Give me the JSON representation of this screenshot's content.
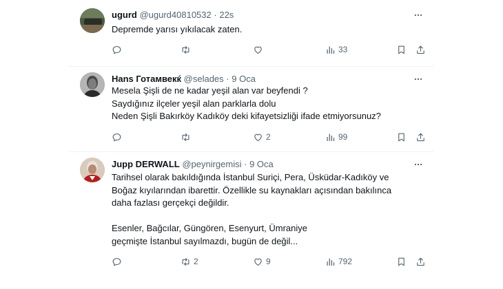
{
  "tweets": [
    {
      "name": "ugurd",
      "handle": "@ugurd40810532",
      "dot": "·",
      "time": "22s",
      "lines": [
        "Depremde yarısı yıkılacak zaten."
      ],
      "replies": "",
      "retweets": "",
      "likes": "",
      "views": "33"
    },
    {
      "name": "Hans Готамвекќ",
      "handle": "@selades",
      "dot": "·",
      "time": "9 Oca",
      "lines": [
        "Mesela Şişli de ne kadar yeşil alan var beyfendi ?",
        "Saydığınız ilçeler yeşil alan parklarla dolu",
        "Neden Şişli Bakırköy Kadıköy deki kifayetsizliği ifade etmiyorsunuz?"
      ],
      "replies": "",
      "retweets": "",
      "likes": "2",
      "views": "99"
    },
    {
      "name": "Jupp DERWALL",
      "handle": "@peynirgemisi",
      "dot": "·",
      "time": "9 Oca",
      "lines": [
        "Tarihsel olarak bakıldığında İstanbul Suriçi, Pera, Üsküdar-Kadıköy ve",
        "Boğaz kıyılarından ibarettir.  Özellikle su kaynakları açısından bakılınca",
        "daha fazlası gerçekçi değildir.",
        "",
        "Esenler, Bağcılar, Güngören, Esenyurt, Ümraniye",
        "geçmişte İstanbul sayılmazdı, bugün de değil..."
      ],
      "replies": "",
      "retweets": "2",
      "likes": "9",
      "views": "792"
    }
  ],
  "icons": {
    "more": "more-icon",
    "reply": "reply-icon",
    "retweet": "retweet-icon",
    "like": "like-icon",
    "views": "views-icon",
    "bookmark": "bookmark-icon",
    "share": "share-icon"
  },
  "colors": {
    "text": "#0f1419",
    "secondary": "#536471",
    "divider": "#eff3f4"
  }
}
